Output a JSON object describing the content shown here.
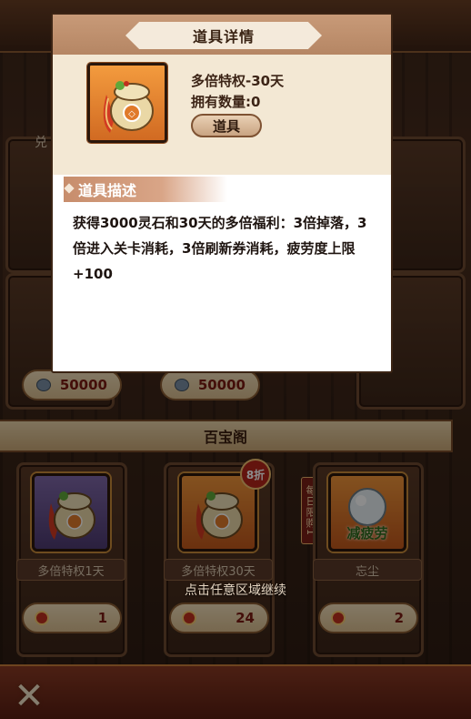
{
  "popup": {
    "title": "道具详情",
    "item_name": "多倍特权-30天",
    "quantity": "拥有数量:0",
    "type_label": "道具",
    "desc_heading": "道具描述",
    "description": "获得3000灵石和30天的多倍福利：3倍掉落，3倍进入关卡消耗，3倍刷新券消耗，疲劳度上限+100",
    "item_icon": "fortune-bag-icon"
  },
  "background": {
    "partial_top_left_label": "兑",
    "prices": [
      "50000",
      "50000"
    ],
    "section_title": "百宝阁",
    "shop_items": [
      {
        "name": "多倍特权1天",
        "price": "1",
        "frame": "purple",
        "icon": "fortune-bag-icon"
      },
      {
        "name": "多倍特权30天",
        "price": "24",
        "frame": "orange",
        "icon": "fortune-bag-icon",
        "discount": "8折"
      },
      {
        "name": "忘尘",
        "price": "2",
        "frame": "orange",
        "icon": "pearl-icon",
        "overlay_text": "减疲劳"
      }
    ],
    "daily_limit": "每日限购1",
    "continue_hint": "点击任意区域继续"
  },
  "colors": {
    "popup_header": "#c89a78",
    "popup_info_bg": "#f3e8d4",
    "orange_frame": "#f0953a",
    "purple_frame": "#7f68a8",
    "price_text": "#7a1a12"
  }
}
